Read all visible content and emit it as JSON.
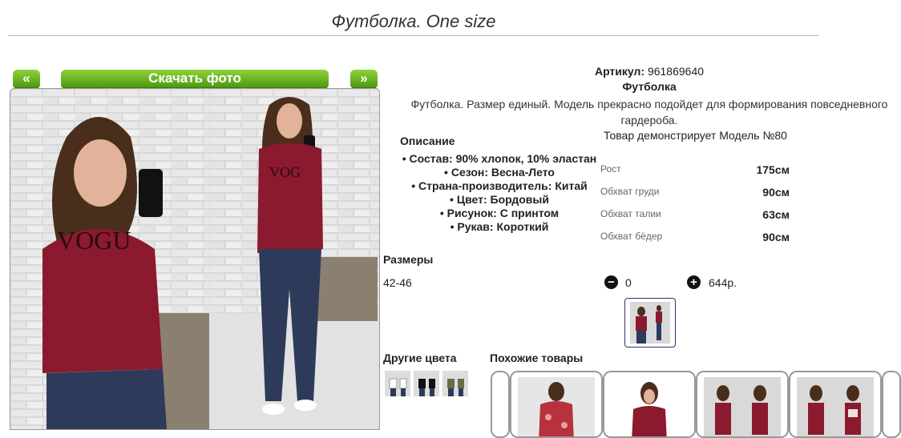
{
  "page_title": "Футболка. One size",
  "gallery": {
    "prev_label": "«",
    "next_label": "»",
    "download_label": "Скачать фото"
  },
  "product": {
    "article_label": "Артикул:",
    "article_value": "961869640",
    "name": "Футболка",
    "description": "Футболка. Размер единый. Модель прекрасно подойдет для формирования повседневного гардероба.",
    "model_note": "Товар демонстрирует Модель №80"
  },
  "specs": {
    "title": "Описание",
    "items": [
      "Состав: 90% хлопок, 10% эластан",
      "Сезон: Весна-Лето",
      "Страна-производитель: Китай",
      "Цвет: Бордовый",
      "Рисунок: С принтом",
      "Рукав: Короткий"
    ]
  },
  "measurements": [
    {
      "label": "Рост",
      "value": "175см"
    },
    {
      "label": "Обхват груди",
      "value": "90см"
    },
    {
      "label": "Обхват талии",
      "value": "63см"
    },
    {
      "label": "Обхват бёдер",
      "value": "90см"
    }
  ],
  "sizes": {
    "title": "Размеры",
    "size": "42-46",
    "quantity": "0",
    "price": "644р.",
    "minus_icon": "minus-circle-icon",
    "plus_icon": "plus-circle-icon"
  },
  "other_colors": {
    "title": "Другие цвета"
  },
  "similar": {
    "title": "Похожие товары"
  },
  "colors": {
    "accent_green": "#5aa818",
    "shirt_burgundy": "#8b1a2e"
  }
}
